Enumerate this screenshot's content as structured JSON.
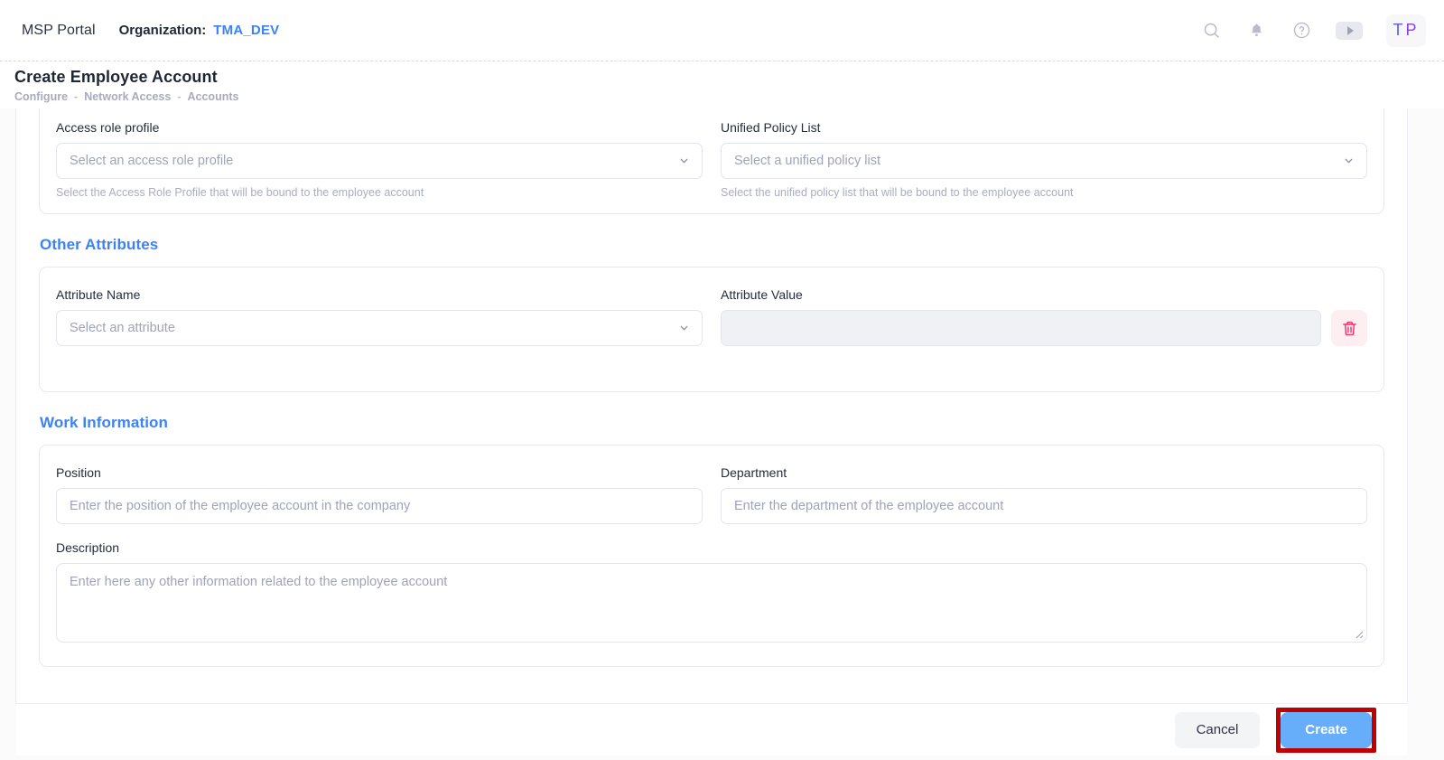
{
  "topbar": {
    "brand": "MSP Portal",
    "org_label": "Organization:",
    "org_value": "TMA_DEV",
    "icons": {
      "search": "search-icon",
      "notifications": "bell-icon",
      "help": "help-circle-icon",
      "video": "video-play-icon"
    },
    "avatar_initial_1": "T",
    "avatar_initial_2": "P"
  },
  "page": {
    "title": "Create Employee Account",
    "breadcrumbs": [
      "Configure",
      "Network Access",
      "Accounts"
    ],
    "separator": "-"
  },
  "access_section": {
    "access_role_profile": {
      "label": "Access role profile",
      "placeholder": "Select an access role profile",
      "hint": "Select the Access Role Profile that will be bound to the employee account"
    },
    "unified_policy_list": {
      "label": "Unified Policy List",
      "placeholder": "Select a unified policy list",
      "hint": "Select the unified policy list that will be bound to the employee account"
    }
  },
  "other_attributes": {
    "title": "Other Attributes",
    "attribute_name": {
      "label": "Attribute Name",
      "placeholder": "Select an attribute",
      "value": ""
    },
    "attribute_value": {
      "label": "Attribute Value",
      "placeholder": "",
      "value": "",
      "disabled": true
    },
    "delete_icon": "trash-icon"
  },
  "work_information": {
    "title": "Work Information",
    "position": {
      "label": "Position",
      "placeholder": "Enter the position of the employee account in the company",
      "value": ""
    },
    "department": {
      "label": "Department",
      "placeholder": "Enter the department of the employee account",
      "value": ""
    },
    "description": {
      "label": "Description",
      "placeholder": "Enter here any other information related to the employee account",
      "value": ""
    }
  },
  "footer": {
    "cancel_label": "Cancel",
    "create_label": "Create"
  },
  "colors": {
    "accent_blue": "#3b82f6",
    "primary_button": "#66aefa",
    "danger": "#f4326a",
    "highlight_box": "#c00000",
    "text_dark": "#1f2634",
    "text_muted": "#a7abbd"
  }
}
